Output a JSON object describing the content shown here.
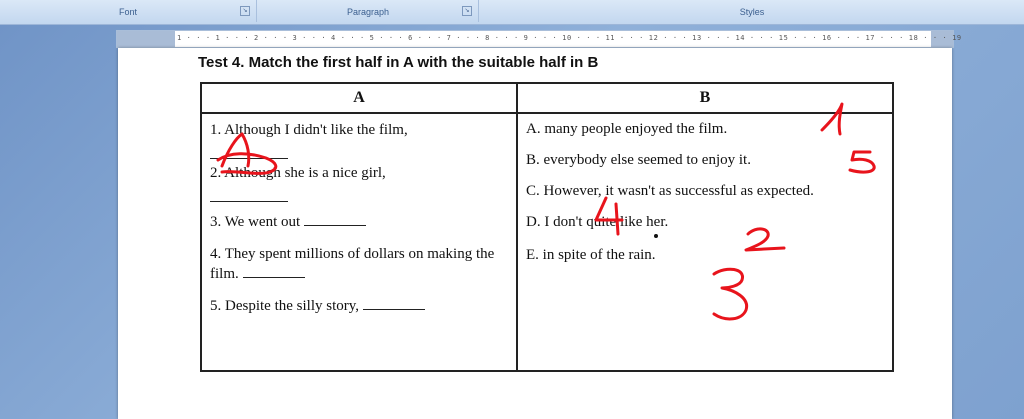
{
  "ribbon": {
    "groups": [
      {
        "label": "Font"
      },
      {
        "label": "Paragraph"
      },
      {
        "label": "Styles"
      }
    ]
  },
  "ruler": {
    "ticks": "1 · · · 1 · · · 2 · · · 3 · · · 4 · · · 5 · · · 6 · · · 7 · · · 8 · · · 9 · · · 10 · · · 11 · · · 12 · · · 13 · · · 14 · · · 15 · · · 16 · · · 17 · · · 18 · · · 19"
  },
  "document": {
    "title": "Test 4. Match the first half in A with the suitable half in B",
    "table": {
      "headers": [
        "A",
        "B"
      ],
      "col_a": [
        "1. Although I didn't like the film,",
        "2. Although she is a nice girl,",
        "3. We went out",
        "4. They spent millions of dollars on making the film.",
        "5. Despite the silly story,"
      ],
      "col_b": [
        "A. many people enjoyed the film.",
        "B. everybody else seemed to enjoy it.",
        "C. However, it wasn't as successful as expected.",
        "D. I don't quite like her.",
        "E. in spite of the rain."
      ]
    },
    "annotations": {
      "answers": [
        "1",
        "5",
        "4",
        "2",
        "3"
      ],
      "color": "#e8141c"
    }
  }
}
